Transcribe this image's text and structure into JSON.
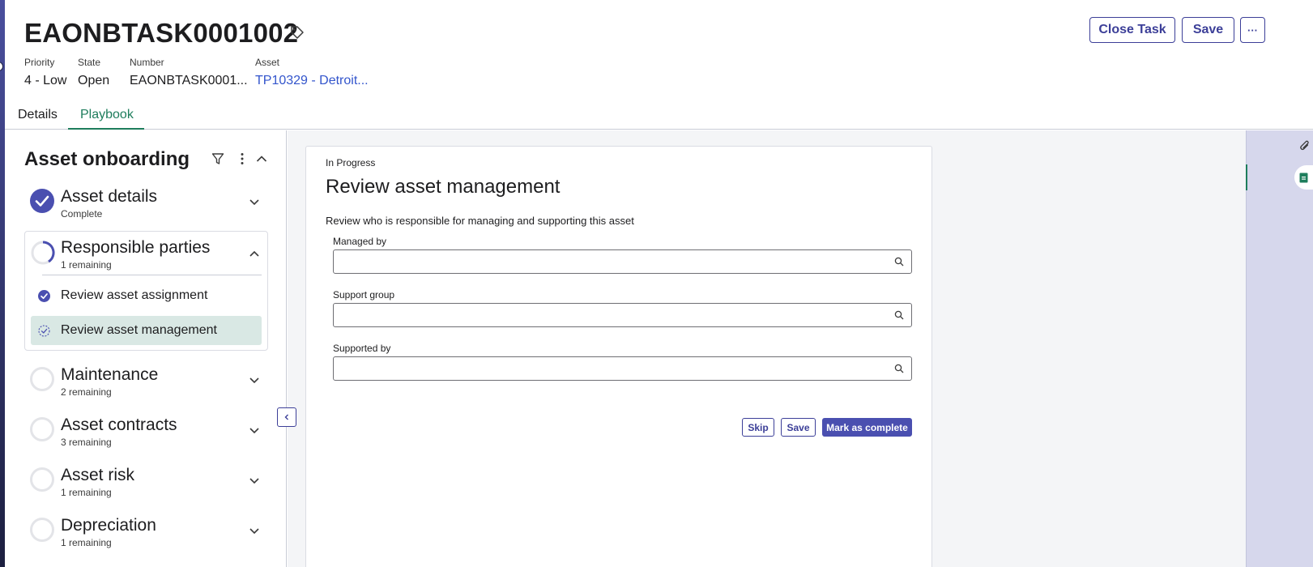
{
  "record": {
    "number_title": "EAONBTASK0001002",
    "fields": [
      {
        "label": "Priority",
        "value": "4 - Low"
      },
      {
        "label": "State",
        "value": "Open"
      },
      {
        "label": "Number",
        "value": "EAONBTASK0001..."
      },
      {
        "label": "Asset",
        "value": "TP10329 - Detroit..."
      }
    ]
  },
  "header_actions": {
    "close_task": "Close Task",
    "save": "Save",
    "more": "···"
  },
  "tabs": [
    {
      "label": "Details",
      "active": false
    },
    {
      "label": "Playbook",
      "active": true
    }
  ],
  "playbook": {
    "title": "Asset onboarding",
    "stages": [
      {
        "name": "Asset details",
        "status": "Complete",
        "state": "complete"
      },
      {
        "name": "Responsible parties",
        "status": "1 remaining",
        "state": "in-progress",
        "expanded": true
      },
      {
        "name": "Maintenance",
        "status": "2 remaining",
        "state": "pending"
      },
      {
        "name": "Asset contracts",
        "status": "3 remaining",
        "state": "pending"
      },
      {
        "name": "Asset risk",
        "status": "1 remaining",
        "state": "pending"
      },
      {
        "name": "Depreciation",
        "status": "1 remaining",
        "state": "pending"
      }
    ],
    "tasks": [
      {
        "label": "Review asset assignment",
        "state": "complete"
      },
      {
        "label": "Review asset management",
        "state": "in-progress",
        "active": true
      }
    ]
  },
  "task_card": {
    "status": "In Progress",
    "title": "Review asset management",
    "description": "Review who is responsible for managing and supporting this asset",
    "fields": [
      {
        "label": "Managed by",
        "value": ""
      },
      {
        "label": "Support group",
        "value": ""
      },
      {
        "label": "Supported by",
        "value": ""
      }
    ],
    "actions": {
      "skip": "Skip",
      "save": "Save",
      "complete": "Mark as complete"
    }
  },
  "colors": {
    "accent": "#3c3f98",
    "primary_button": "#4a4fb0",
    "tab_active": "#1e7d5c",
    "link": "#3355cc",
    "active_task_bg": "#d9e8e4",
    "rail_bg": "#d6d7ec"
  },
  "icons": {
    "tag": "tag-icon",
    "filter": "filter-icon",
    "kebab": "more-vertical-icon",
    "chevron": "chevron-icon",
    "search": "search-icon",
    "attachment": "paperclip-icon",
    "sheet": "document-icon"
  }
}
